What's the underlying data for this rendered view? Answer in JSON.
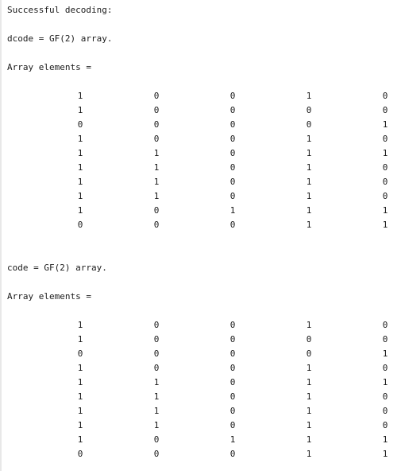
{
  "console": {
    "status_line": "Successful decoding:",
    "dcode_decl": "dcode = GF(2) array.",
    "dcode_elements_label": "Array elements =",
    "dcode_matrix": [
      [
        "1",
        "0",
        "0",
        "1",
        "0"
      ],
      [
        "1",
        "0",
        "0",
        "0",
        "0"
      ],
      [
        "0",
        "0",
        "0",
        "0",
        "1"
      ],
      [
        "1",
        "0",
        "0",
        "1",
        "0"
      ],
      [
        "1",
        "1",
        "0",
        "1",
        "1"
      ],
      [
        "1",
        "1",
        "0",
        "1",
        "0"
      ],
      [
        "1",
        "1",
        "0",
        "1",
        "0"
      ],
      [
        "1",
        "1",
        "0",
        "1",
        "0"
      ],
      [
        "1",
        "0",
        "1",
        "1",
        "1"
      ],
      [
        "0",
        "0",
        "0",
        "1",
        "1"
      ]
    ],
    "code_decl": "code = GF(2) array.",
    "code_elements_label": "Array elements =",
    "code_matrix": [
      [
        "1",
        "0",
        "0",
        "1",
        "0"
      ],
      [
        "1",
        "0",
        "0",
        "0",
        "0"
      ],
      [
        "0",
        "0",
        "0",
        "0",
        "1"
      ],
      [
        "1",
        "0",
        "0",
        "1",
        "0"
      ],
      [
        "1",
        "1",
        "0",
        "1",
        "1"
      ],
      [
        "1",
        "1",
        "0",
        "1",
        "0"
      ],
      [
        "1",
        "1",
        "0",
        "1",
        "0"
      ],
      [
        "1",
        "1",
        "0",
        "1",
        "0"
      ],
      [
        "1",
        "0",
        "1",
        "1",
        "1"
      ],
      [
        "0",
        "0",
        "0",
        "1",
        "1"
      ]
    ]
  }
}
